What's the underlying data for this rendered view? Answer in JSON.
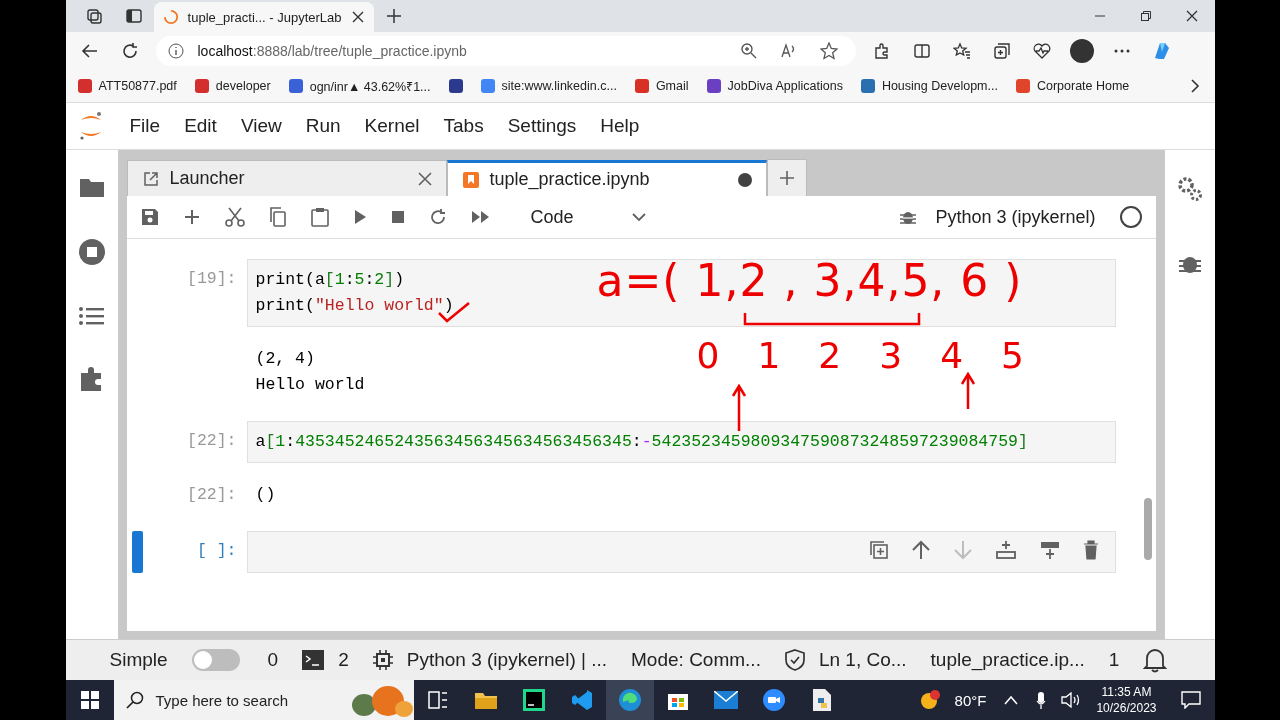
{
  "browser": {
    "tabs": [
      {
        "title": "tuple_practi... - JupyterLab",
        "selected": true
      }
    ],
    "address": {
      "host": "localhost",
      "path": ":8888/lab/tree/tuple_practice.ipynb"
    },
    "bookmarks": [
      {
        "label": "ATT50877.pdf",
        "kind": "pdf"
      },
      {
        "label": "developer",
        "kind": "pdf"
      },
      {
        "label": "ogn/inr▲ 43.62%₹1...",
        "kind": "chart"
      },
      {
        "kind": "badge"
      },
      {
        "label": "site:www.linkedin.c...",
        "kind": "google"
      },
      {
        "label": "Gmail",
        "kind": "mail"
      },
      {
        "label": "JobDiva Applications",
        "kind": "jobdiva"
      },
      {
        "label": "Housing Developm...",
        "kind": "bse"
      },
      {
        "label": "Corporate Home",
        "kind": "circle"
      }
    ]
  },
  "menu": [
    "File",
    "Edit",
    "View",
    "Run",
    "Kernel",
    "Tabs",
    "Settings",
    "Help"
  ],
  "doc_tabs": [
    {
      "label": "Launcher",
      "kind": "launcher",
      "selected": false,
      "unsaved": false
    },
    {
      "label": "tuple_practice.ipynb",
      "kind": "notebook",
      "selected": true,
      "unsaved": true
    }
  ],
  "toolbar": {
    "cell_type": "Code",
    "kernel": "Python 3 (ipykernel)"
  },
  "cells": [
    {
      "kind": "code",
      "prompt": "[19]:",
      "selected": false,
      "lines": [
        [
          {
            "t": "print(a",
            "kind": "plain"
          },
          {
            "t": "[",
            "kind": "bracket"
          },
          {
            "t": "1",
            "kind": "num"
          },
          {
            "t": ":",
            "kind": "plain"
          },
          {
            "t": "5",
            "kind": "num"
          },
          {
            "t": ":",
            "kind": "plain"
          },
          {
            "t": "2",
            "kind": "num"
          },
          {
            "t": "]",
            "kind": "bracket"
          },
          {
            "t": ")",
            "kind": "plain"
          }
        ],
        [
          {
            "t": "print(",
            "kind": "plain"
          },
          {
            "t": "\"Hello world\"",
            "kind": "str"
          },
          {
            "t": ")",
            "kind": "plain"
          }
        ]
      ]
    },
    {
      "kind": "output",
      "selected": false,
      "lines": [
        [
          {
            "t": "(2, 4)",
            "kind": "plain"
          }
        ],
        [
          {
            "t": "Hello world",
            "kind": "plain"
          }
        ]
      ]
    },
    {
      "kind": "code",
      "prompt": "[22]:",
      "selected": false,
      "lines": [
        [
          {
            "t": "a",
            "kind": "plain"
          },
          {
            "t": "[",
            "kind": "bracket"
          },
          {
            "t": "1",
            "kind": "num"
          },
          {
            "t": ":",
            "kind": "plain"
          },
          {
            "t": "4353452465243563456345634563456345",
            "kind": "num"
          },
          {
            "t": ":",
            "kind": "plain"
          },
          {
            "t": "-",
            "kind": "op"
          },
          {
            "t": "5423523459809347590873248597239084759",
            "kind": "num"
          },
          {
            "t": "]",
            "kind": "bracket"
          }
        ]
      ]
    },
    {
      "kind": "output",
      "prompt": "[22]:",
      "selected": false,
      "lines": [
        [
          {
            "t": "()",
            "kind": "plain"
          }
        ]
      ]
    },
    {
      "kind": "code",
      "prompt": "[ ]:",
      "selected": true
    }
  ],
  "annotation": {
    "expression": "a=( 1,2 , 3,4,5, 6 )",
    "indices": [
      "0",
      "1",
      "2",
      "3",
      "4",
      "5"
    ]
  },
  "status_bar": {
    "mode_label": "Simple",
    "simple_on": false,
    "terminals": "0",
    "kernels": "2",
    "kernel": "Python 3 (ipykernel) | ...",
    "mode": "Mode: Comm...",
    "position": "Ln 1, Co...",
    "file": "tuple_practice.ip...",
    "notifications": "1"
  },
  "taskbar": {
    "search_placeholder": "Type here to search",
    "weather": "80°F",
    "time": "11:35 AM",
    "date": "10/26/2023"
  }
}
